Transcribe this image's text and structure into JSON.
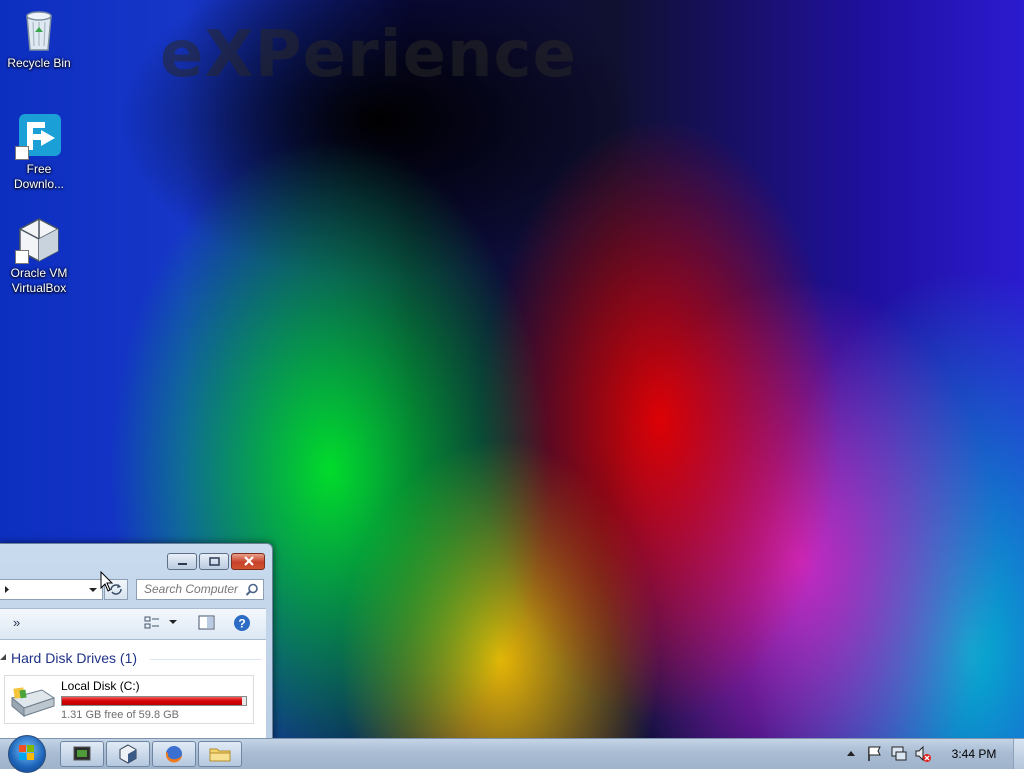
{
  "desktop": {
    "watermark": "eXPerience",
    "icons": [
      {
        "label": "Recycle Bin",
        "icon": "recycle-bin-icon"
      },
      {
        "label": "Free Downlo...",
        "icon": "free-download-manager-icon"
      },
      {
        "label": "Oracle VM VirtualBox",
        "icon": "virtualbox-icon"
      }
    ]
  },
  "explorer": {
    "search_placeholder": "Search Computer",
    "toolbar_overflow": "»",
    "group_header": "Hard Disk Drives (1)",
    "drive": {
      "name": "Local Disk (C:)",
      "free_text": "1.31 GB free of 59.8 GB",
      "used_fraction": 0.978,
      "bar_color": "#d70000"
    }
  },
  "taskbar": {
    "pinned": [
      "media-player-icon",
      "virtualbox-icon",
      "firefox-icon",
      "windows-explorer-icon"
    ],
    "tray_icons": [
      "show-hidden-icons-arrow-icon",
      "action-center-flag-icon",
      "network-icon",
      "volume-muted-icon"
    ],
    "clock": "3:44 PM"
  }
}
